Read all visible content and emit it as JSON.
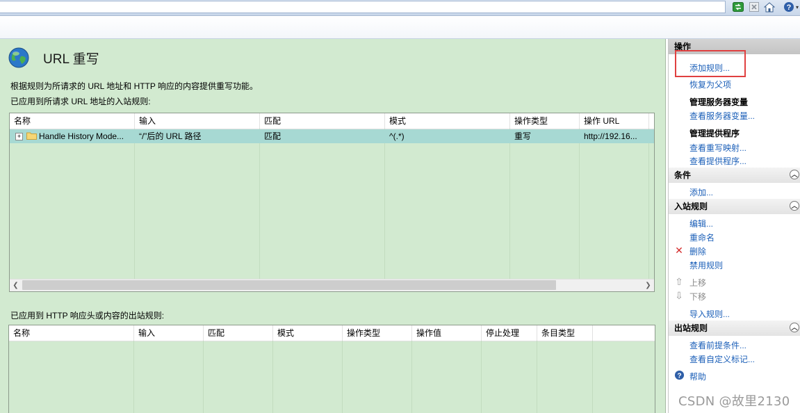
{
  "page": {
    "title": "URL 重写",
    "description": "根据规则为所请求的 URL 地址和 HTTP 响应的内容提供重写功能。",
    "inbound_label": "已应用到所请求 URL 地址的入站规则:",
    "outbound_label": "已应用到 HTTP 响应头或内容的出站规则:"
  },
  "inbound": {
    "columns": [
      "名称",
      "输入",
      "匹配",
      "模式",
      "操作类型",
      "操作 URL"
    ],
    "rows": [
      {
        "expander": "⊞",
        "name": "Handle History Mode...",
        "input": "“/”后的 URL 路径",
        "match": "匹配",
        "pattern": "^(.*)",
        "action_type": "重写",
        "action_url": "http://192.16..."
      }
    ]
  },
  "outbound": {
    "columns": [
      "名称",
      "输入",
      "匹配",
      "模式",
      "操作类型",
      "操作值",
      "停止处理",
      "条目类型"
    ]
  },
  "actions": {
    "header_ops": "操作",
    "add_rule": "添加规则...",
    "revert_parent": "恢复为父项",
    "manage_server_vars_title": "管理服务器变量",
    "view_server_vars": "查看服务器变量...",
    "manage_providers_title": "管理提供程序",
    "view_rewrite_maps": "查看重写映射...",
    "view_providers": "查看提供程序...",
    "conditions_header": "条件",
    "add_condition": "添加...",
    "inbound_header": "入站规则",
    "edit": "编辑...",
    "rename": "重命名",
    "delete": "删除",
    "disable_rule": "禁用规则",
    "move_up": "上移",
    "move_down": "下移",
    "import_rules": "导入规则...",
    "outbound_header": "出站规则",
    "view_preconditions": "查看前提条件...",
    "view_custom_tags": "查看自定义标记...",
    "help": "帮助"
  },
  "watermark": "CSDN @故里2130",
  "colors": {
    "panel_green": "#d2ead0",
    "selected_row": "#a7d9d3",
    "link_blue": "#1b5fb8",
    "highlight_red": "#e04040"
  }
}
